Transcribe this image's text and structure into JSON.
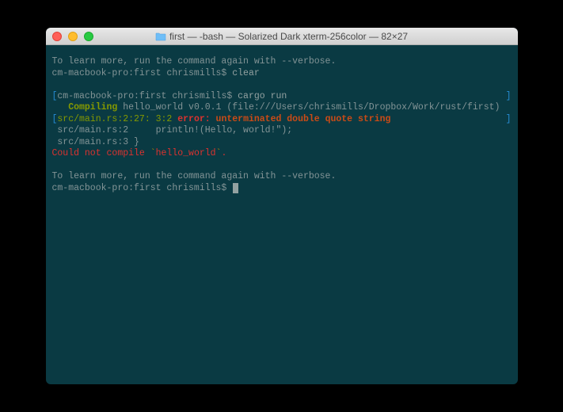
{
  "window": {
    "title": "first — -bash — Solarized Dark xterm-256color — 82×27"
  },
  "terminal": {
    "line1": "To learn more, run the command again with --verbose.",
    "prompt1": "cm-macbook-pro:first chrismills$ ",
    "cmd1": "clear",
    "open_bracket": "[",
    "prompt2": "cm-macbook-pro:first chrismills$ ",
    "cmd2": "cargo run",
    "close_bracket": "]",
    "compiling_label": "   Compiling",
    "compiling_rest": " hello_world v0.0.1 (file:///Users/chrismills/Dropbox/Work/rust/first)",
    "src_bracket_open": "[",
    "src_loc1": "src/main.rs:2:27: 3:2 ",
    "error_word": "error:",
    "error_msg": " unterminated double quote string",
    "src_bracket_close": "]",
    "src2": " src/main.rs:2     println!(Hello, world!\");",
    "src3": " src/main.rs:3 }",
    "could_not": "Could not compile ",
    "tick": "`",
    "pkg": "hello_world",
    "tick2": "`",
    "period": ".",
    "line_verbose2": "To learn more, run the command again with --verbose.",
    "prompt3": "cm-macbook-pro:first chrismills$ "
  }
}
